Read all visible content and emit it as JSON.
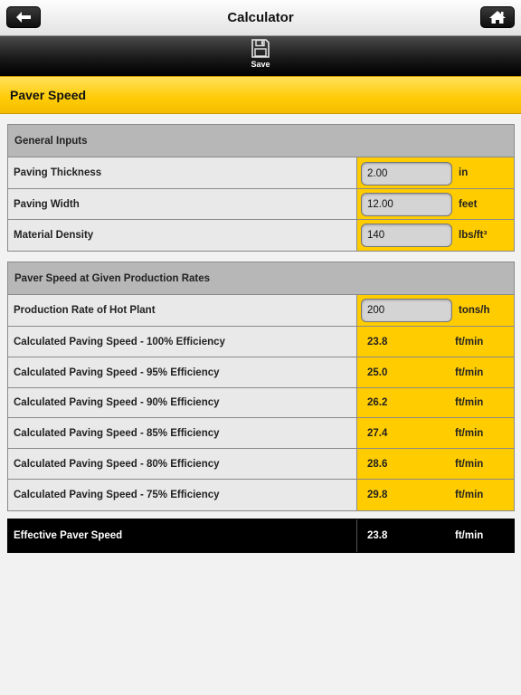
{
  "nav": {
    "title": "Calculator",
    "back_icon": "back-arrow-icon",
    "home_icon": "home-icon"
  },
  "toolbar": {
    "save_label": "Save",
    "save_icon": "floppy-disk-icon"
  },
  "section": {
    "title": "Paver Speed"
  },
  "general_inputs": {
    "header": "General Inputs",
    "rows": [
      {
        "label": "Paving Thickness",
        "value": "2.00",
        "unit": "in"
      },
      {
        "label": "Paving Width",
        "value": "12.00",
        "unit": "feet"
      },
      {
        "label": "Material Density",
        "value": "140",
        "unit": "lbs/ft³"
      }
    ]
  },
  "production": {
    "header": "Paver Speed at Given Production Rates",
    "input": {
      "label": "Production Rate of Hot Plant",
      "value": "200",
      "unit": "tons/h"
    },
    "rows": [
      {
        "label": "Calculated Paving Speed - 100% Efficiency",
        "value": "23.8",
        "unit": "ft/min"
      },
      {
        "label": "Calculated Paving Speed - 95% Efficiency",
        "value": "25.0",
        "unit": "ft/min"
      },
      {
        "label": "Calculated Paving Speed - 90% Efficiency",
        "value": "26.2",
        "unit": "ft/min"
      },
      {
        "label": "Calculated Paving Speed - 85% Efficiency",
        "value": "27.4",
        "unit": "ft/min"
      },
      {
        "label": "Calculated Paving Speed - 80% Efficiency",
        "value": "28.6",
        "unit": "ft/min"
      },
      {
        "label": "Calculated Paving Speed - 75% Efficiency",
        "value": "29.8",
        "unit": "ft/min"
      }
    ]
  },
  "result": {
    "label": "Effective Paver Speed",
    "value": "23.8",
    "unit": "ft/min"
  },
  "colors": {
    "accent_yellow": "#ffcc00",
    "header_gray": "#b7b7b7",
    "label_gray": "#e9e9e9",
    "result_black": "#000000"
  }
}
